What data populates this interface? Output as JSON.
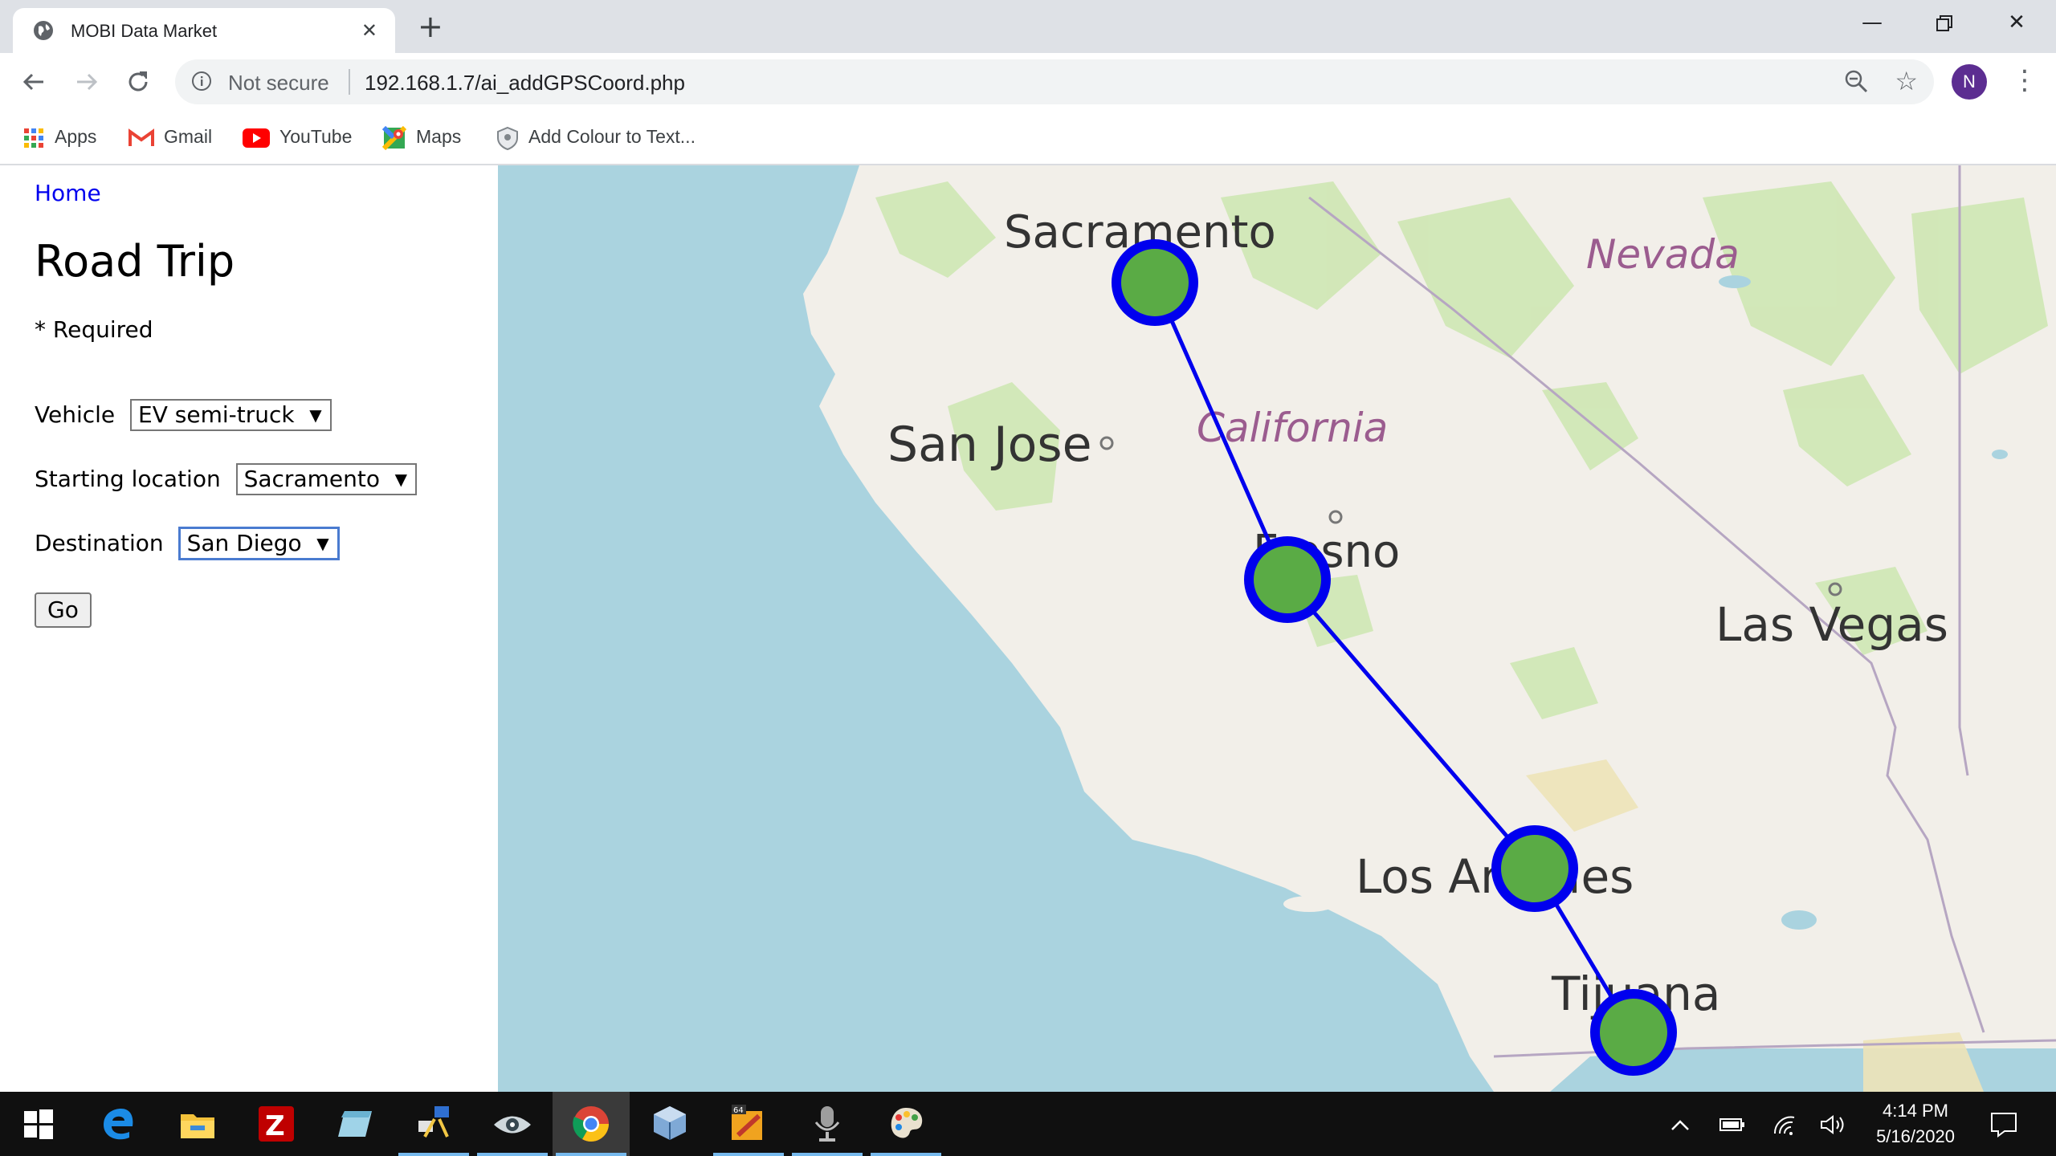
{
  "browser": {
    "tab": {
      "title": "MOBI Data Market"
    },
    "omnibox": {
      "security": "Not secure",
      "url": "192.168.1.7/ai_addGPSCoord.php"
    },
    "profile_initial": "N",
    "bookmarks": [
      "Apps",
      "Gmail",
      "YouTube",
      "Maps",
      "Add Colour to Text..."
    ]
  },
  "page": {
    "home_link": "Home",
    "title": "Road Trip",
    "required_note": "* Required",
    "form": {
      "vehicle_label": "Vehicle",
      "vehicle_value": "EV semi-truck",
      "start_label": "Starting location",
      "start_value": "Sacramento",
      "destination_label": "Destination",
      "destination_value": "San Diego",
      "go_label": "Go"
    }
  },
  "map": {
    "labels": {
      "sacramento": "Sacramento",
      "nevada": "Nevada",
      "san_jose": "San Jose",
      "california": "California",
      "fresno": "Fresno",
      "las_vegas": "Las Vegas",
      "los_angeles": "Los Angeles",
      "tijuana": "Tijuana"
    },
    "route_stops": [
      "Sacramento",
      "Fresno",
      "Los Angeles",
      "Tijuana"
    ],
    "colors": {
      "route": "#0000ee",
      "marker_fill": "#5aab45",
      "water": "#aad3df",
      "land": "#f2efe9"
    }
  },
  "taskbar": {
    "clock_time": "4:14 PM",
    "clock_date": "5/16/2020",
    "apps": [
      "windows-start",
      "edge",
      "file-explorer",
      "filezilla",
      "notepad",
      "network-tool",
      "eye-app",
      "chrome",
      "virtualbox",
      "sublime-64",
      "microphone-app",
      "paint-app"
    ]
  }
}
